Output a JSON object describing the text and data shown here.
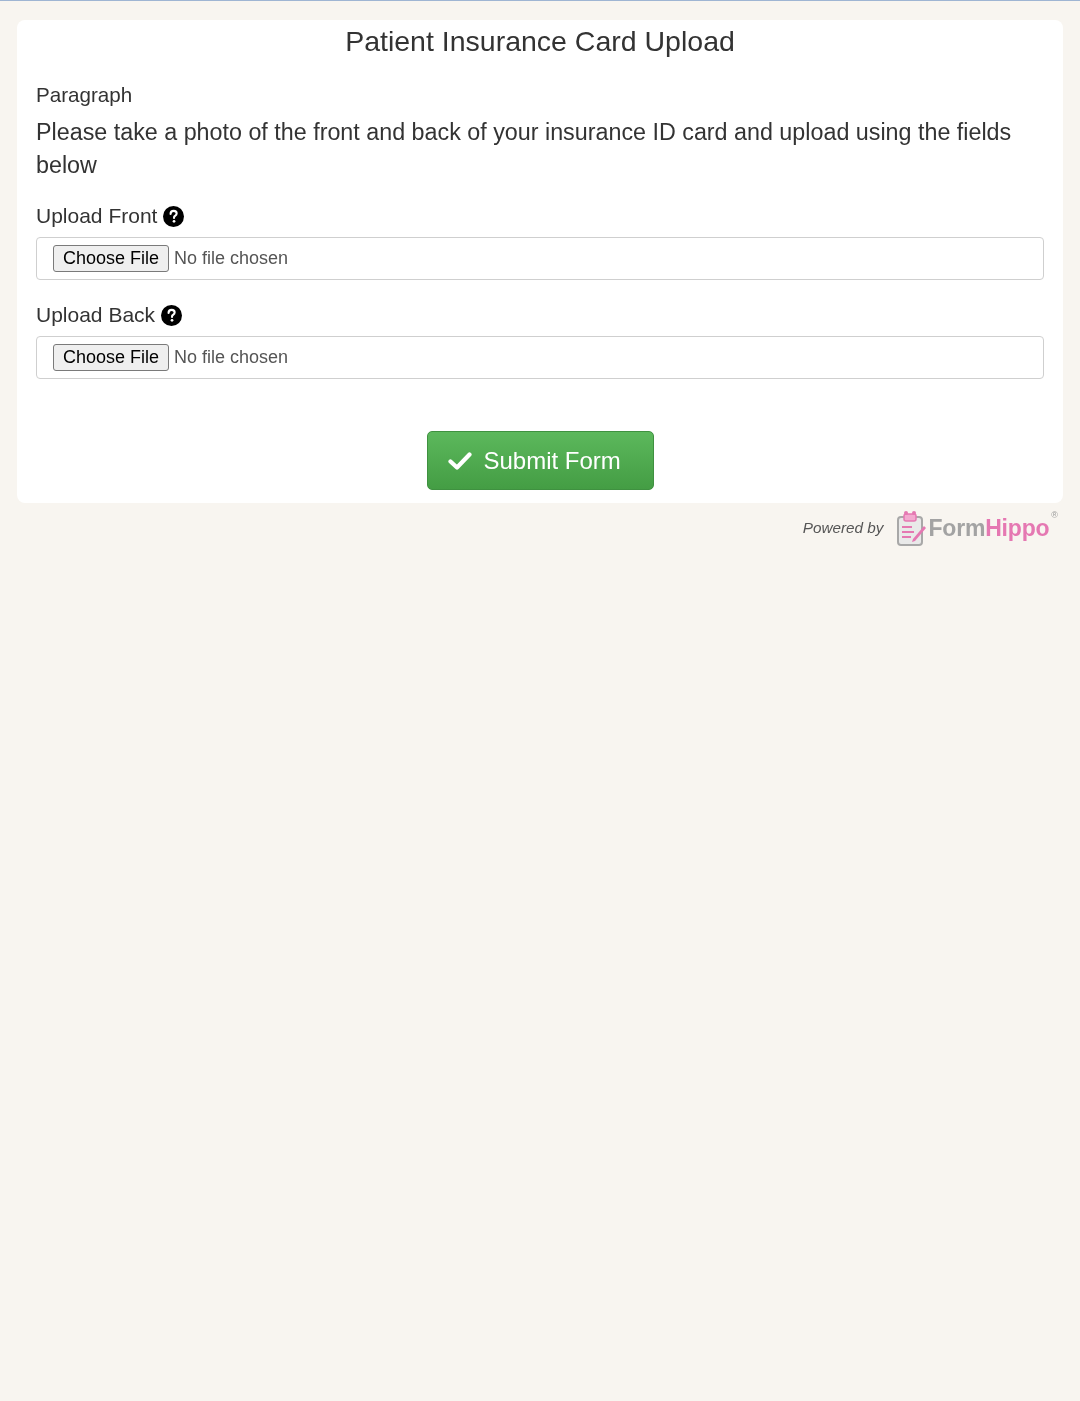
{
  "form": {
    "title": "Patient Insurance Card Upload",
    "paragraph_label": "Paragraph",
    "paragraph_text": "Please take a photo of the front and back of your insurance ID card and upload using the fields below",
    "fields": [
      {
        "label": "Upload Front",
        "help": true,
        "button": "Choose File",
        "status": "No file chosen"
      },
      {
        "label": "Upload Back",
        "help": true,
        "button": "Choose File",
        "status": "No file chosen"
      }
    ],
    "submit_button": "Submit Form"
  },
  "footer": {
    "powered_by": "Powered by",
    "logo": {
      "parts": [
        {
          "text": "Form",
          "color": "#a3a3a3"
        },
        {
          "text": "Hippo",
          "color": "#e578b2"
        }
      ],
      "mark": "®"
    }
  }
}
